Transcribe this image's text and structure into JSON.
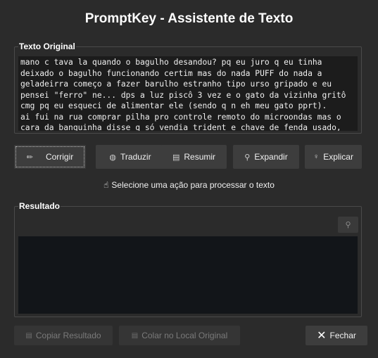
{
  "window": {
    "title": "PromptKey - Assistente de Texto"
  },
  "original": {
    "label": "Texto Original",
    "text": "mano c tava la quando o bagulho desandou? pq eu juro q eu tinha\ndeixado o bagulho funcionando certim mas do nada PUFF do nada a\ngeladeirra começo a fazer barulho estranho tipo urso gripado e eu\npensei \"ferro\" ne... dps a luz piscô 3 vez e o gato da vizinha gritô\ncmg pq eu esqueci de alimentar ele (sendo q n eh meu gato pprt).\nai fui na rua comprar pilha pro controle remoto do microondas mas o\ncara da banquinha disse q só vendia trident e chave de fenda usado,"
  },
  "actions": {
    "corrigir": {
      "label": "Corrigir",
      "icon": "pencil-icon"
    },
    "traduzir": {
      "label": "Traduzir",
      "icon": "globe-icon"
    },
    "resumir": {
      "label": "Resumir",
      "icon": "document-icon"
    },
    "expandir": {
      "label": "Expandir",
      "icon": "magnifier-icon"
    },
    "explicar": {
      "label": "Explicar",
      "icon": "lightbulb-icon"
    }
  },
  "hint": {
    "text": "Selecione uma ação para processar o texto",
    "icon": "pointing-hand-icon"
  },
  "result": {
    "label": "Resultado",
    "search_icon": "magnifier-icon",
    "text": ""
  },
  "footer": {
    "copy_label": "Copiar Resultado",
    "paste_label": "Colar no Local Original",
    "close_label": "Fechar"
  },
  "colors": {
    "background": "#2b2b2b",
    "text_area": "#1c1c1c",
    "result_area": "#121519",
    "button": "#3d3d3d"
  }
}
